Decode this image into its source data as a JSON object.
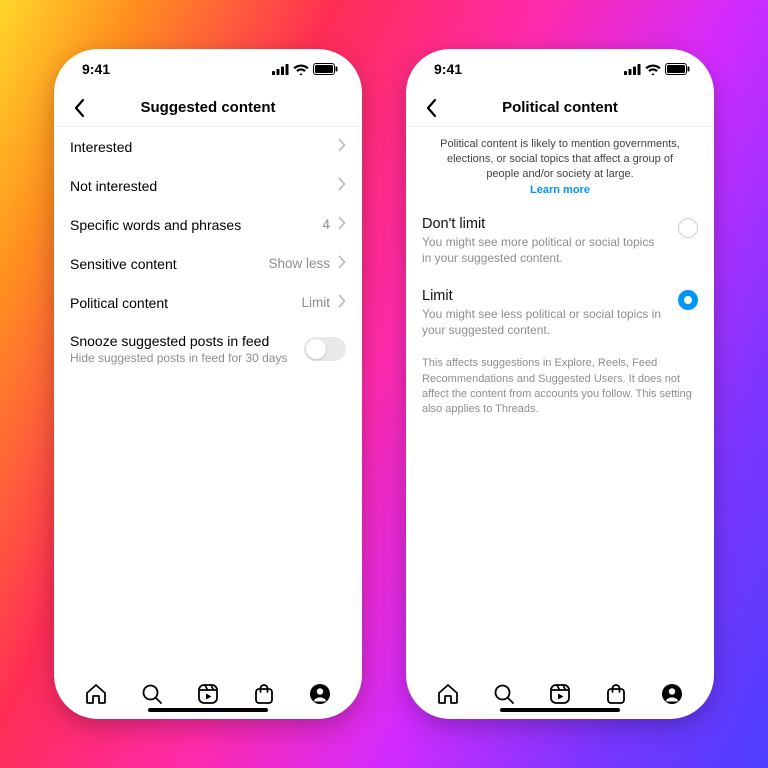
{
  "status": {
    "time": "9:41"
  },
  "left": {
    "title": "Suggested content",
    "rows": {
      "interested": "Interested",
      "not_interested": "Not interested",
      "words": "Specific words and phrases",
      "words_count": "4",
      "sensitive": "Sensitive content",
      "sensitive_value": "Show less",
      "political": "Political content",
      "political_value": "Limit",
      "snooze": "Snooze suggested posts in feed",
      "snooze_sub": "Hide suggested posts in feed for 30 days"
    }
  },
  "right": {
    "title": "Political content",
    "blurb": "Political content is likely to mention governments, elections, or social topics that affect a group of people and/or society at large.",
    "learn_more": "Learn more",
    "opt1": {
      "title": "Don't limit",
      "desc": "You might see more political or social topics in your suggested content."
    },
    "opt2": {
      "title": "Limit",
      "desc": "You might see less political or social topics in your suggested content."
    },
    "footnote": "This affects suggestions in Explore, Reels, Feed Recommendations and Suggested Users. It does not affect the content from accounts you follow. This setting also applies to Threads."
  }
}
